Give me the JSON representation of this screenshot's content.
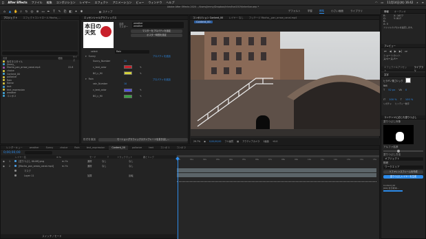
{
  "menubar": {
    "app": "After Effects",
    "items": [
      "ファイル",
      "編集",
      "コンポジション",
      "レイヤー",
      "エフェクト",
      "アニメーション",
      "ビュー",
      "ウィンドウ",
      "ヘルプ"
    ],
    "clock": "11月14日(木) 16:42"
  },
  "window_title": "Adobe After Effects 2020 - /Users/jimmy/Dropbox/inter/live2019/interlive.aep *",
  "toolbar": {
    "snap_label": "スナップ",
    "workspaces": [
      "デフォルト",
      "学習",
      "標準",
      "小さい画面",
      "ライブラリ"
    ],
    "active_workspace": "標準",
    "search_placeholder": "ヘルプを検索"
  },
  "project_panel": {
    "tabs": [
      "プロジェクト",
      "エフェクトコントロール Mocha_..."
    ],
    "columns": {
      "name": "名前",
      "type": "種類",
      "size": "サイズ"
    },
    "items": [
      {
        "name": "色付きスタイル",
        "color": "#d0c040"
      },
      {
        "name": "Jimmy_",
        "color": "#40a0d0"
      },
      {
        "name": "Mocha_pan_arrow_canal.mp4",
        "color": "#a050a0",
        "size": "22.8"
      },
      {
        "name": "choice",
        "color": "#d0c040"
      },
      {
        "name": "Content_00",
        "color": "#40a0d0"
      },
      {
        "name": "pollarize",
        "color": "#d0c040"
      },
      {
        "name": "Rain",
        "color": "#d0c040"
      },
      {
        "name": "Name",
        "color": "#d0c040"
      },
      {
        "name": "text",
        "color": "#40a0d0"
      },
      {
        "name": "text_expression",
        "color": "#d0c040"
      },
      {
        "name": "weather",
        "color": "#40a0d0"
      },
      {
        "name": "コンポ 2",
        "color": "#40a0d0"
      }
    ]
  },
  "essential_graphics": {
    "tab": "エッセンシャルグラフィックス",
    "logo_text_1": "本日の",
    "logo_text_2": "天気",
    "name_label": "名前",
    "name_value": "weather",
    "master_label": "マスター",
    "master_value": "weather",
    "set_poster_button": "マスターをプロパティを設定",
    "poster_button": "ポスター時間を設定",
    "select_label": "select",
    "select_value": "Rain",
    "groups": [
      {
        "name": "Sunny",
        "props": [
          {
            "label": "Sunny_Number",
            "value": "20",
            "type": "number"
          },
          {
            "label": "c_text_color",
            "color": "#c8202a",
            "type": "color"
          },
          {
            "label": "BG_c_fill",
            "color": "#d4d23a",
            "type": "color"
          }
        ]
      },
      {
        "name": "Rain",
        "props": [
          {
            "label": "rain_Number",
            "value": "10",
            "type": "number"
          },
          {
            "label": "c_text_color",
            "color": "#5050e0",
            "type": "color"
          },
          {
            "label": "BG_c_fill",
            "color": "#38a040",
            "type": "color"
          }
        ]
      }
    ],
    "add_props_label": "プロパティを追加",
    "format_label": "形式を追加",
    "export_button": "モーショングラフィックステンプレートを書き出し..."
  },
  "composition": {
    "tabs": [
      "コンポジション Content_00",
      "レイヤー なし",
      "フッテージ Mocha__pan_arrow_canal.mp4"
    ],
    "breadcrumb": "Content_00",
    "footer": {
      "zoom": "29.7%",
      "time": "0;00;00;00",
      "quality": "フル画質",
      "camera": "アクティブカメラ",
      "view": "1画面",
      "exposure": "+0.0"
    }
  },
  "right_panel": {
    "info_tabs": [
      "情報",
      "オーディオ"
    ],
    "info_lines": [
      "R:",
      "G:",
      "B:",
      "A: 0",
      "X: 1677",
      "Y: 807"
    ],
    "info_note": "ファイルカプセルを設定します。",
    "preview_tab": "プレビュー",
    "shortcut_label": "ショートカット",
    "shortcut_value": "スペースバー",
    "effects_tab": "エフェクト&プリセット",
    "library_tab": "ライブラリ",
    "character_tab": "文字",
    "font": "ヒラギノ角ゴシック",
    "weight": "W4",
    "font_size": "52 px",
    "tracking": "0",
    "scale_v": "100 %",
    "scale_h": "100 %",
    "opt1": "リガチャ",
    "opt2": "ヒンディー数字",
    "content_aware_tab": "コンテンツに応じた塗りつぶし",
    "fill_target_label": "塗りつぶし対象",
    "alpha_label": "アルファ拡張",
    "method_label": "塗りつぶし方法",
    "method_value": "オブジェクト",
    "range_label": "範囲",
    "range_value": "ワークエリア",
    "ref_frame_button": "リファレンスフレームを作成",
    "generate_button": "塗りつぶしレイヤーを生成",
    "status_line1": "Content_00",
    "status_line2": "[DR] を分析中..."
  },
  "timeline": {
    "tabs": [
      "レンダーキュー",
      "weather",
      "Sunny",
      "choice",
      "Rain",
      "text_expression",
      "Content_00",
      "pollarize",
      "text",
      "コンポ 1",
      "コンポ 2"
    ],
    "active_tab": "Content_00",
    "timecode": "0;00;00;00",
    "columns": [
      "レイヤー名",
      "モード",
      "T",
      "トラックマット",
      "親とリンク"
    ],
    "layers": [
      {
        "num": "1",
        "name": "[塗りつぶし 00-06].png",
        "mode": "通常",
        "track": "なし",
        "parent": "なし",
        "color": "#4a9adb"
      },
      {
        "num": "2",
        "name": "[Mocha_pan_arrow_canal.mp4]",
        "mode": "通常",
        "track": "なし",
        "parent": "なし",
        "color": "#4a9adb"
      },
      {
        "num": "",
        "name": "マスク",
        "mode": "",
        "track": "",
        "parent": "",
        "color": "#888"
      },
      {
        "num": "",
        "name": "Layer 11",
        "mode": "加算",
        "track": "",
        "parent": "反転",
        "color": "#888"
      }
    ],
    "ruler_ticks": [
      "00s",
      "01s",
      "02s",
      "03s",
      "04s",
      "05s",
      "06s",
      "07s",
      "08s",
      "09s",
      "10s",
      "11s",
      "12s",
      "13s",
      "14s",
      "15s"
    ],
    "footer_label": "スイッチ / モード"
  }
}
